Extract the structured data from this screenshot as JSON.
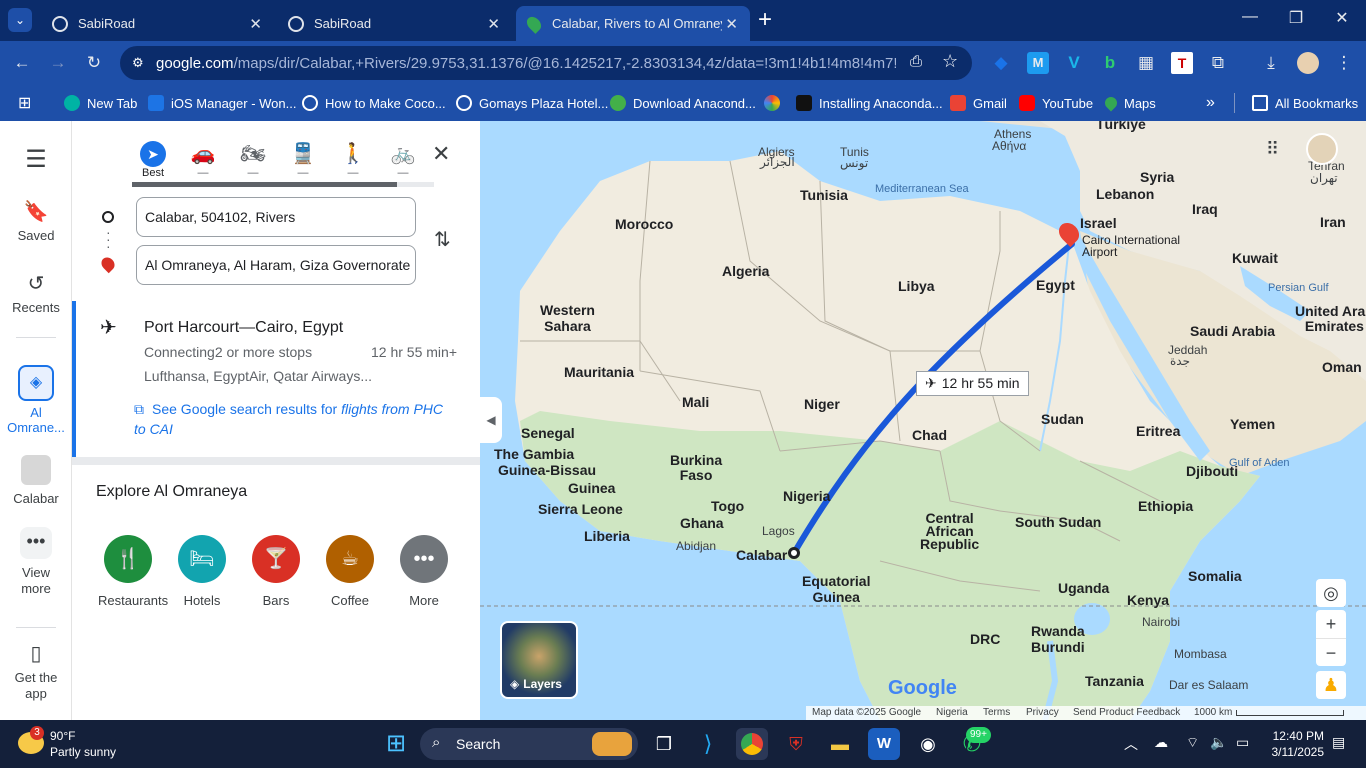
{
  "browser": {
    "tabs": [
      {
        "title": "SabiRoad",
        "active": false
      },
      {
        "title": "SabiRoad",
        "active": false
      },
      {
        "title": "Calabar, Rivers to Al Omraneya,",
        "active": true
      }
    ],
    "new_tab_label": "+",
    "url_host": "google.com",
    "url_path": "/maps/dir/Calabar,+Rivers/29.9753,31.1376/@16.1425217,-2.8303134,4z/data=!3m1!4b1!4m8!4m7!1m5!1...",
    "bookmarks": [
      "New Tab",
      "iOS Manager - Won...",
      "How to Make Coco...",
      "Gomays Plaza Hotel...",
      "Download Anacond...",
      "Installing Anaconda...",
      "Gmail",
      "YouTube",
      "Maps"
    ],
    "more_bookmarks": "»",
    "all_bookmarks": "All Bookmarks"
  },
  "rail": {
    "saved": "Saved",
    "recents": "Recents",
    "al_omraneya": "Al Omrane...",
    "calabar": "Calabar",
    "view_more": "View more",
    "get_app": "Get the app"
  },
  "directions": {
    "modes": [
      "Best",
      "—",
      "—",
      "—",
      "—",
      "—"
    ],
    "origin": "Calabar, 504102, Rivers",
    "destination": "Al Omraneya, Al Haram, Giza Governorate",
    "route": {
      "title": "Port Harcourt—Cairo, Egypt",
      "stops": "Connecting2 or more stops",
      "duration": "12 hr 55 min+",
      "airlines": "Lufthansa, EgyptAir, Qatar Airways...",
      "search_prefix": "See Google search results for ",
      "search_italic": "flights from PHC to CAI"
    },
    "explore_title": "Explore Al Omraneya",
    "explore": [
      {
        "label": "Restaurants",
        "color": "#1e8e3e",
        "icon": "fork-knife-icon"
      },
      {
        "label": "Hotels",
        "color": "#12a4af",
        "icon": "bed-icon"
      },
      {
        "label": "Bars",
        "color": "#d93025",
        "icon": "cocktail-icon"
      },
      {
        "label": "Coffee",
        "color": "#b06000",
        "icon": "coffee-icon"
      },
      {
        "label": "More",
        "color": "#70757a",
        "icon": "more-icon"
      }
    ]
  },
  "map": {
    "flight_time": "12 hr 55 min",
    "layers": "Layers",
    "labels": {
      "turkiye": "Türkiye",
      "athens": "Athens",
      "athens_gr": "Αθήνα",
      "algiers": "Algiers",
      "algiers_ar": "الجزائر",
      "tunis": "Tunis",
      "tunis_ar": "تونس",
      "tunisia": "Tunisia",
      "med": "Mediterranean Sea",
      "syria": "Syria",
      "lebanon": "Lebanon",
      "iraq": "Iraq",
      "tehran": "Tehran",
      "tehran_fa": "تهران",
      "iran": "Iran",
      "morocco": "Morocco",
      "israel": "Israel",
      "cairo": "Cairo International",
      "airport": "Airport",
      "algeria": "Algeria",
      "libya": "Libya",
      "egypt": "Egypt",
      "kuwait": "Kuwait",
      "persian": "Persian Gulf",
      "western": "Western",
      "sahara": "Sahara",
      "uae1": "United Arab",
      "uae2": "Emirates",
      "saudi": "Saudi Arabia",
      "jeddah": "Jeddah",
      "jeddah_ar": "جدة",
      "oman": "Oman",
      "mauritania": "Mauritania",
      "mali": "Mali",
      "niger": "Niger",
      "chad": "Chad",
      "sudan": "Sudan",
      "eritrea": "Eritrea",
      "yemen": "Yemen",
      "senegal": "Senegal",
      "gambia": "The Gambia",
      "gbissau": "Guinea-Bissau",
      "burkina1": "Burkina",
      "burkina2": "Faso",
      "djibouti": "Djibouti",
      "aden": "Gulf of Aden",
      "guinea": "Guinea",
      "nigeria": "Nigeria",
      "ethiopia": "Ethiopia",
      "sierra": "Sierra Leone",
      "togo": "Togo",
      "ghana": "Ghana",
      "lagos": "Lagos",
      "car1": "Central",
      "car2": "African",
      "car3": "Republic",
      "ssudan": "South Sudan",
      "liberia": "Liberia",
      "abidjan": "Abidjan",
      "calabar": "Calabar",
      "somalia": "Somalia",
      "eqg1": "Equatorial",
      "eqg2": "Guinea",
      "uganda": "Uganda",
      "kenya": "Kenya",
      "nairobi": "Nairobi",
      "drc": "DRC",
      "rwanda": "Rwanda",
      "burundi": "Burundi",
      "mombasa": "Mombasa",
      "tanzania": "Tanzania",
      "dar": "Dar es Salaam"
    },
    "footer": [
      "Map data ©2025 Google",
      "Nigeria",
      "Terms",
      "Privacy",
      "Send Product Feedback",
      "1000 km"
    ],
    "google": "Google"
  },
  "taskbar": {
    "temp": "90°F",
    "weather": "Partly sunny",
    "weather_badge": "3",
    "search": "Search",
    "whatsapp_badge": "99+",
    "time": "12:40 PM",
    "date": "3/11/2025"
  }
}
